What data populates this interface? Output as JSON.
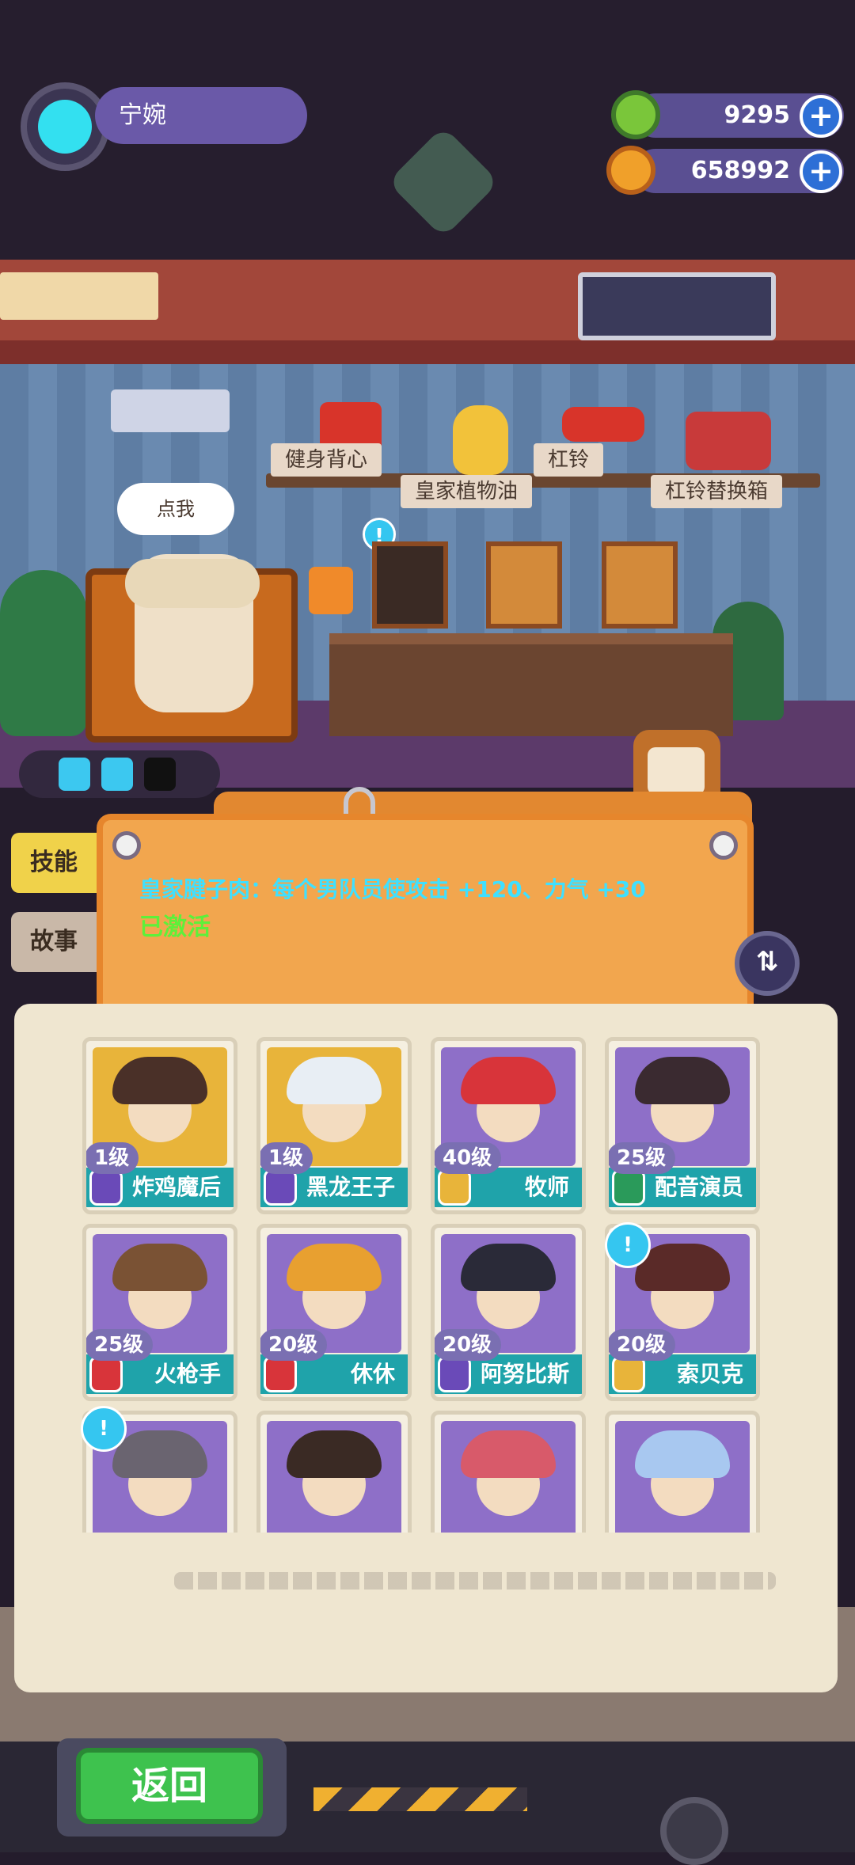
{
  "player": {
    "name": "宁婉"
  },
  "currency": {
    "gems": "9295",
    "coins": "658992",
    "plus": "+"
  },
  "room": {
    "speech": "点我",
    "items": [
      "健身背心",
      "皇家植物油",
      "杠铃",
      "杠铃替换箱"
    ]
  },
  "panel": {
    "skill_text": "皇家腱子肉：每个男队员使攻击 +120、力气 +30",
    "status": "已激活",
    "tab_skill": "技能",
    "tab_story": "故事"
  },
  "characters": [
    {
      "level": "1级",
      "name": "炸鸡魔后",
      "bg": "#e8b43a",
      "hair": "#4a3028",
      "badge": "#6a4ab8"
    },
    {
      "level": "1级",
      "name": "黑龙王子",
      "bg": "#e8b43a",
      "hair": "#e8eef4",
      "badge": "#6a4ab8"
    },
    {
      "level": "40级",
      "name": "牧师",
      "bg": "#8e6fc8",
      "hair": "#d8343a",
      "badge": "#e8b43a"
    },
    {
      "level": "25级",
      "name": "配音演员",
      "bg": "#8e6fc8",
      "hair": "#3a2a30",
      "badge": "#2a9a5a"
    },
    {
      "level": "25级",
      "name": "火枪手",
      "bg": "#8e6fc8",
      "hair": "#7a5234",
      "badge": "#d8343a"
    },
    {
      "level": "20级",
      "name": "休休",
      "bg": "#8e6fc8",
      "hair": "#e8a030",
      "badge": "#d8343a"
    },
    {
      "level": "20级",
      "name": "阿努比斯",
      "bg": "#8e6fc8",
      "hair": "#2a2a38",
      "badge": "#6a4ab8"
    },
    {
      "level": "20级",
      "name": "索贝克",
      "bg": "#8e6fc8",
      "hair": "#5a2a28",
      "badge": "#e8b43a"
    },
    {
      "level": "",
      "name": "",
      "bg": "#8e6fc8",
      "hair": "#6a6470",
      "badge": "#6a4ab8"
    },
    {
      "level": "",
      "name": "",
      "bg": "#8e6fc8",
      "hair": "#3a2a24",
      "badge": "#6a4ab8"
    },
    {
      "level": "",
      "name": "",
      "bg": "#8e6fc8",
      "hair": "#d85a6a",
      "badge": "#6a4ab8"
    },
    {
      "level": "",
      "name": "",
      "bg": "#8e6fc8",
      "hair": "#a8c8f0",
      "badge": "#6a4ab8"
    }
  ],
  "buttons": {
    "back": "返回"
  },
  "colors": {
    "accent_cyan": "#3fe0ff",
    "active_green": "#5ef03a",
    "panel_orange": "#f2a64e",
    "name_teal": "#1fa3aa"
  }
}
